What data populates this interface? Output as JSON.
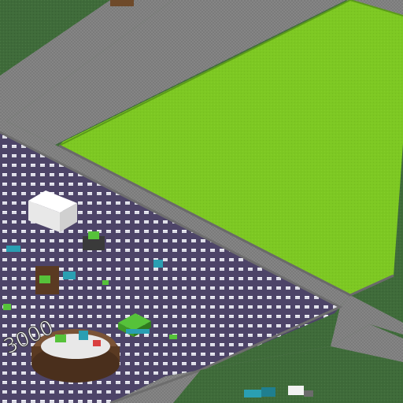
{
  "colors": {
    "grass_dark": "#3f6b3a",
    "grass_bright": "#7dc823",
    "road": "#7d7d7d",
    "curb": "#a5a5a5",
    "plaza": "#4d4468",
    "plaza_tile": "#dcdce6",
    "white_block": "#f2f2f2",
    "green_object": "#56c23a",
    "cyan_object": "#2a9fb2",
    "wood": "#5a3a22"
  },
  "objects": [
    {
      "name": "white-box-building-icon"
    },
    {
      "name": "round-wooden-structure-icon"
    },
    {
      "name": "white-letter-sculpture-icon"
    },
    {
      "name": "green-frame-structure-icon"
    },
    {
      "name": "vehicle-cluster-icon"
    },
    {
      "name": "small-debris-icons"
    }
  ],
  "sign": {
    "text": "3000"
  }
}
